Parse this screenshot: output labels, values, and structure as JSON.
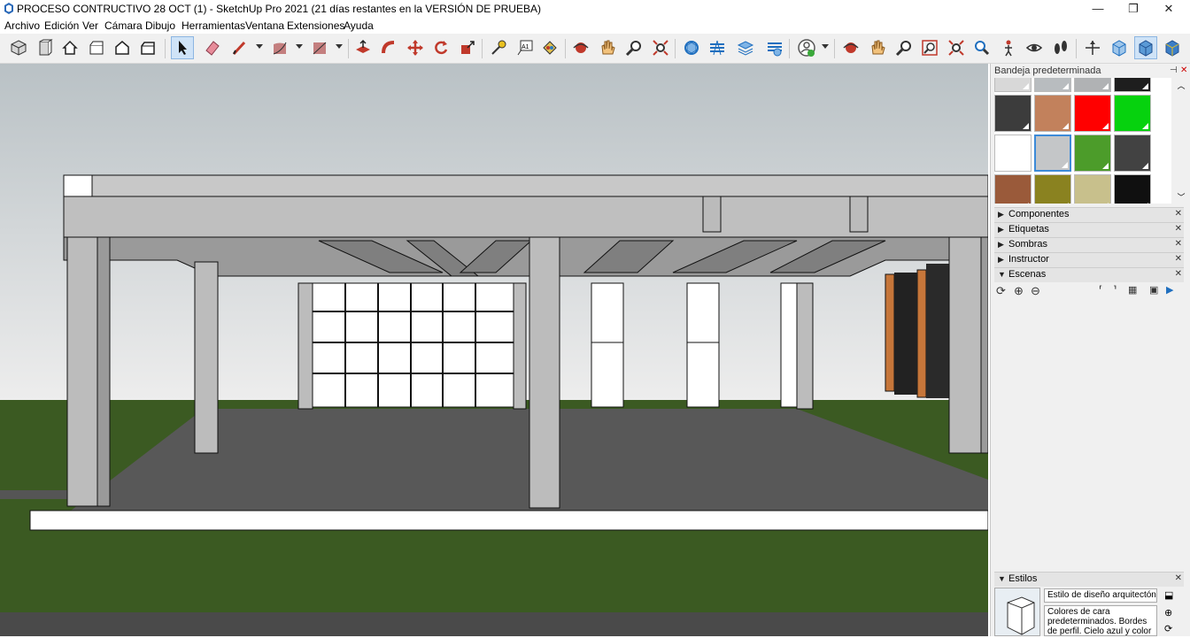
{
  "window": {
    "title": "PROCESO CONTRUCTIVO 28 OCT (1) - SketchUp Pro 2021 (21 días restantes en la VERSIÓN DE PRUEBA)",
    "minimize": "—",
    "maximize": "❐",
    "close": "✕"
  },
  "menu": [
    "Archivo",
    "Edición",
    "Ver",
    "Cámara",
    "Dibujo",
    "Herramientas",
    "Ventana",
    "Extensiones",
    "Ayuda"
  ],
  "toolbar": {
    "tools": [
      "iso-view-icon",
      "front-view-icon",
      "home-view-icon",
      "top-view-icon",
      "back-view-icon",
      "side-view-icon",
      "select-icon",
      "eraser-icon",
      "pencil-line-icon",
      "arc-icon",
      "rectangle-icon",
      "push-pull-icon",
      "follow-me-icon",
      "move-icon",
      "rotate-icon",
      "scale-icon",
      "tape-measure-icon",
      "text-label-icon",
      "paint-bucket-icon",
      "orbit-icon",
      "pan-icon",
      "zoom-icon",
      "zoom-extents-icon",
      "solid-tools-icon",
      "section-plane-icon",
      "layers-icon",
      "sandbox-icon",
      "profile-user-icon",
      "orbit-2-icon",
      "pan-2-icon",
      "zoom-2-icon",
      "zoom-window-icon",
      "zoom-extents-2-icon",
      "previous-view-icon",
      "position-camera-icon",
      "look-around-icon",
      "walk-icon",
      "axes-icon",
      "xray-icon",
      "shaded-icon",
      "textured-icon"
    ],
    "active_tool": "select-icon"
  },
  "tray": {
    "title": "Bandeja predeterminada",
    "pin": "⊣",
    "close": "✕",
    "swatches": [
      "#d8d8d8",
      "#b8bcbf",
      "#b0b2b4",
      "#1e1e1e",
      "#3c3c3c",
      "#c2815c",
      "#ff0000",
      "#06d20e",
      "#ffffff",
      "#c4c6c8",
      "#4c9c2a",
      "#424242",
      "#9a5a3a",
      "#8a8220",
      "#c8c08c",
      "#101010"
    ],
    "selected_swatch": 9,
    "panels": [
      {
        "label": "Componentes",
        "expanded": false
      },
      {
        "label": "Etiquetas",
        "expanded": false
      },
      {
        "label": "Sombras",
        "expanded": false
      },
      {
        "label": "Instructor",
        "expanded": false
      },
      {
        "label": "Escenas",
        "expanded": true
      }
    ],
    "scene_tools": [
      "refresh-icon",
      "add-scene-icon",
      "remove-scene-icon",
      "move-up-icon",
      "move-down-icon",
      "view-options-icon",
      "details-icon",
      "expand-icon"
    ],
    "estilos": {
      "label": "Estilos",
      "style_name": "Estilo de diseño arquitectónico",
      "description": "Colores de cara predeterminados. Bordes de perfil. Cielo azul y color de"
    }
  },
  "colors": {
    "sky_top": "#b9c1c5",
    "sky_bottom": "#ededed",
    "grass": "#3b5a22",
    "floor": "#585858",
    "concrete": "#bcbcbc",
    "accent": "#3c8ad8"
  }
}
